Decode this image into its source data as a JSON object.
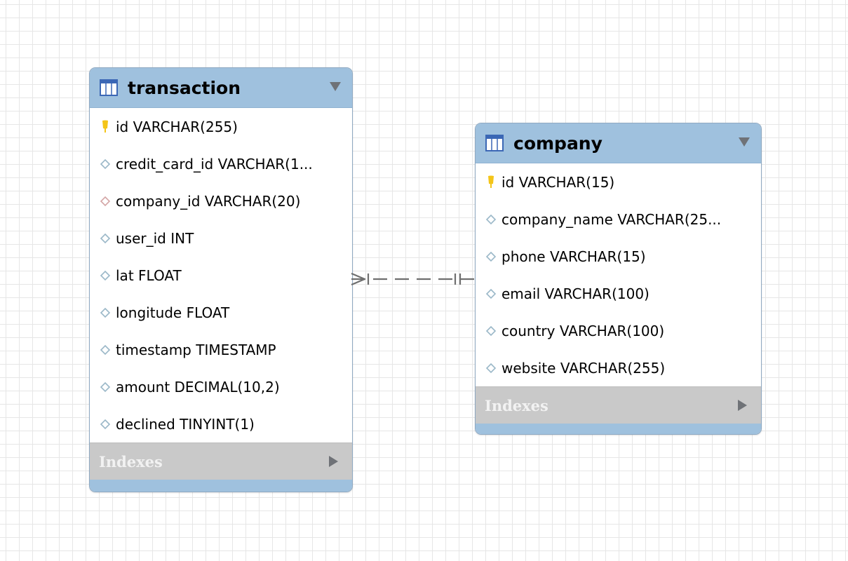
{
  "tables": {
    "transaction": {
      "name": "transaction",
      "columns": [
        {
          "text": "id VARCHAR(255)",
          "icon": "primary-key-icon"
        },
        {
          "text": "credit_card_id VARCHAR(1...",
          "icon": "column-icon"
        },
        {
          "text": "company_id VARCHAR(20)",
          "icon": "foreign-key-icon"
        },
        {
          "text": "user_id INT",
          "icon": "column-icon"
        },
        {
          "text": "lat FLOAT",
          "icon": "column-icon"
        },
        {
          "text": "longitude FLOAT",
          "icon": "column-icon"
        },
        {
          "text": "timestamp TIMESTAMP",
          "icon": "column-icon"
        },
        {
          "text": "amount DECIMAL(10,2)",
          "icon": "column-icon"
        },
        {
          "text": "declined TINYINT(1)",
          "icon": "column-icon"
        }
      ],
      "indexes_label": "Indexes"
    },
    "company": {
      "name": "company",
      "columns": [
        {
          "text": "id VARCHAR(15)",
          "icon": "primary-key-icon"
        },
        {
          "text": "company_name VARCHAR(25...",
          "icon": "column-icon"
        },
        {
          "text": "phone VARCHAR(15)",
          "icon": "column-icon"
        },
        {
          "text": "email VARCHAR(100)",
          "icon": "column-icon"
        },
        {
          "text": "country VARCHAR(100)",
          "icon": "column-icon"
        },
        {
          "text": "website VARCHAR(255)",
          "icon": "column-icon"
        }
      ],
      "indexes_label": "Indexes"
    }
  },
  "relationship": {
    "from": "transaction",
    "to": "company",
    "from_cardinality": "many",
    "to_cardinality": "one",
    "line_style": "dashed"
  },
  "colors": {
    "header": "#9fc1de",
    "indexes_bar": "#c9c9c9",
    "primary_key": "#f4c518",
    "column_diamond": "#9bb8c8",
    "foreign_key_diamond": "#d4a6a6",
    "relation_line": "#6f6f6f",
    "grid": "#e6e6e6"
  }
}
